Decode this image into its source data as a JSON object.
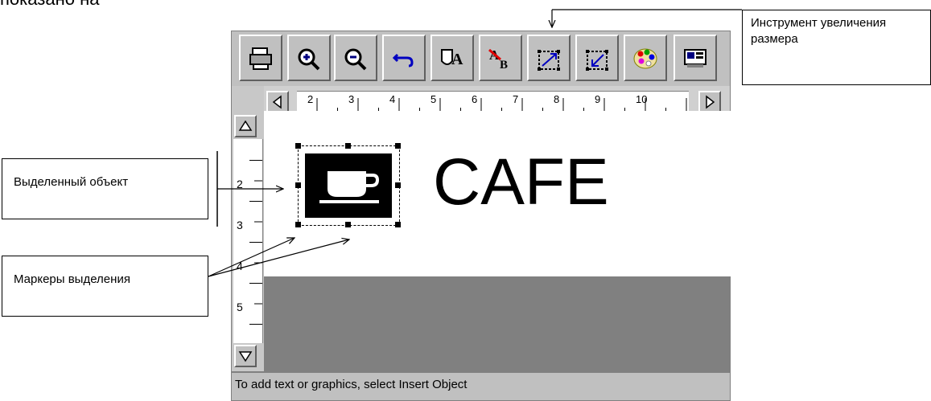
{
  "top_caption": "показано на",
  "callouts": {
    "tool": "Инструмент увеличения размера",
    "selected": "Выделенный объект",
    "markers": "Маркеры выделения"
  },
  "canvas": {
    "text": "CAFE"
  },
  "status_bar": {
    "text": "To add text or graphics, select Insert Object"
  },
  "ruler": {
    "horizontal": [
      "2",
      "3",
      "4",
      "5",
      "6",
      "7",
      "8",
      "9",
      "10"
    ],
    "vertical": [
      "2",
      "3",
      "4",
      "5"
    ]
  },
  "toolbar": {
    "icons": [
      "printer-icon",
      "zoom-in-icon",
      "zoom-out-icon",
      "undo-icon",
      "text-frame-icon",
      "text-color-icon",
      "enlarge-tool-icon",
      "shrink-tool-icon",
      "palette-icon",
      "picture-icon"
    ]
  }
}
